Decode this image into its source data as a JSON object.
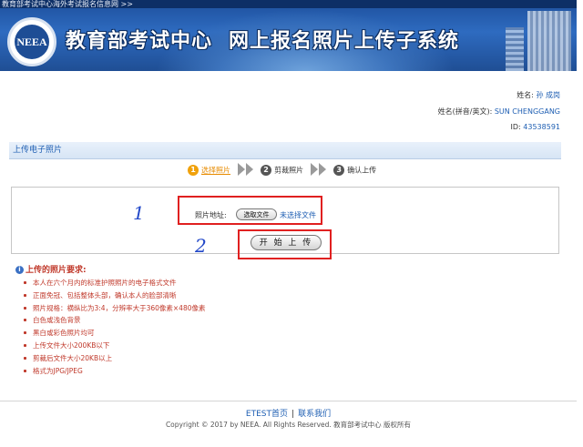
{
  "banner": {
    "top_text": "教育部考试中心海外考试报名信息网 >>",
    "logo_text": "NEEA",
    "title_left": "教育部考试中心",
    "title_right": "网上报名照片上传子系统"
  },
  "user": {
    "name_label": "姓名:",
    "name_value": "孙 成岗",
    "pinyin_label": "姓名(拼音/英文):",
    "pinyin_value": "SUN CHENGGANG",
    "id_label": "ID:",
    "id_value": "43538591"
  },
  "section": {
    "title": "上传电子照片"
  },
  "steps": [
    {
      "number": "1",
      "label": "选择照片"
    },
    {
      "number": "2",
      "label": "剪裁照片"
    },
    {
      "number": "3",
      "label": "确认上传"
    }
  ],
  "upload": {
    "photo_label": "照片地址:",
    "choose_button": "选取文件",
    "no_file_text": "未选择文件",
    "start_button": "开 始 上 传"
  },
  "annotations": {
    "mark1": "1",
    "mark2": "2"
  },
  "requirements": {
    "title": "上传的照片要求:",
    "items": [
      "本人在六个月内的标准护照照片的电子格式文件",
      "正面免冠、包括整体头部，确认本人的脸部清晰",
      "照片规格：横纵比为3:4，分辨率大于360像素×480像素",
      "白色或浅色背景",
      "黑白或彩色照片均可",
      "上传文件大小200KB以下",
      "剪裁后文件大小20KB以上",
      "格式为JPG/JPEG"
    ]
  },
  "footer": {
    "link1": "ETEST首页",
    "separator": "|",
    "link2": "联系我们",
    "copyright": "Copyright © 2017 by NEEA. All Rights Reserved. 教育部考试中心 版权所有"
  }
}
